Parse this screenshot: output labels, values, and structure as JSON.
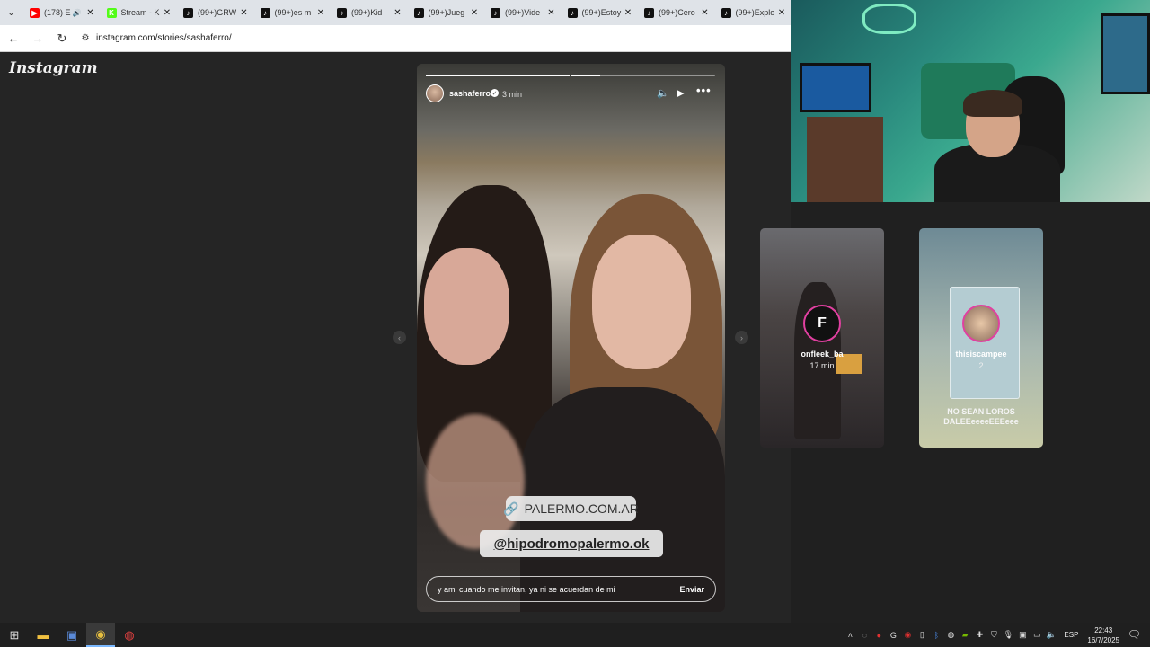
{
  "browser": {
    "tabs": [
      {
        "label": "(178) E",
        "icon": "youtube-icon",
        "color": "#ff0000",
        "audio": true
      },
      {
        "label": "Stream - K",
        "icon": "kick-icon",
        "color": "#53fc18"
      },
      {
        "label": "(99+)GRW",
        "icon": "tiktok-icon",
        "color": "#111111"
      },
      {
        "label": "(99+)es m",
        "icon": "tiktok-icon",
        "color": "#111111"
      },
      {
        "label": "(99+)Kid",
        "icon": "tiktok-icon",
        "color": "#111111"
      },
      {
        "label": "(99+)Jueg",
        "icon": "tiktok-icon",
        "color": "#111111"
      },
      {
        "label": "(99+)Vide",
        "icon": "tiktok-icon",
        "color": "#111111"
      },
      {
        "label": "(99+)Estoy",
        "icon": "tiktok-icon",
        "color": "#111111"
      },
      {
        "label": "(99+)Cero",
        "icon": "tiktok-icon",
        "color": "#111111"
      },
      {
        "label": "(99+)Explo",
        "icon": "tiktok-icon",
        "color": "#111111"
      }
    ],
    "url": "instagram.com/stories/sashaferro/"
  },
  "instagram": {
    "logo": "Instagram"
  },
  "story": {
    "username": "sashaferro",
    "time": "3 min",
    "progress_segments": [
      1,
      0.2,
      0
    ],
    "link_sticker": "PALERMO.COM.AR",
    "mention_sticker": "@hipodromopalermo.ok",
    "reply_text": "y ami cuando me invitan, ya ni se acuerdan de mi",
    "send_label": "Enviar"
  },
  "side_stories": [
    {
      "name": "onfleek_ba",
      "time": "17 min"
    },
    {
      "name": "thisiscampee",
      "time": "2",
      "caption": "NO SEAN LOROS DALEEeeeeEEEeee"
    }
  ],
  "taskbar": {
    "language": "ESP",
    "time": "22:43",
    "date": "16/7/2025"
  },
  "colors": {
    "tab_strip": "#dfe3e8",
    "page_bg": "#252525",
    "taskbar": "#1f1f1f",
    "story_ring": "#e040a0"
  }
}
